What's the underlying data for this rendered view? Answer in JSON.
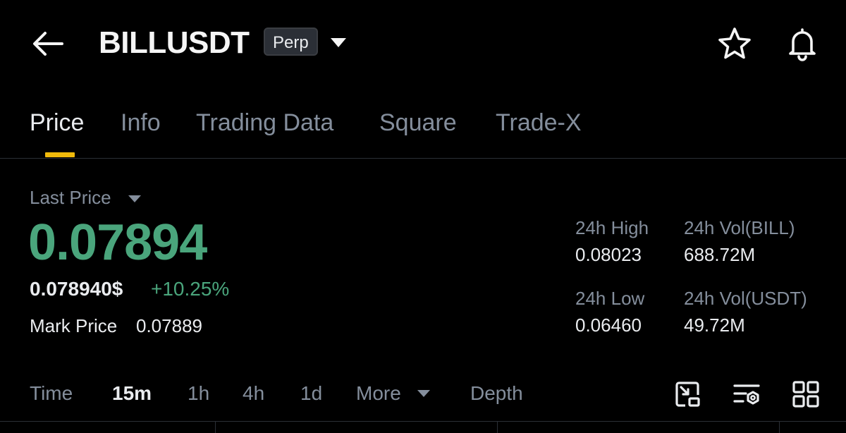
{
  "header": {
    "symbol": "BILLUSDT",
    "contract_type": "Perp",
    "icons": [
      "back-arrow-icon",
      "caret-down-icon",
      "star-icon",
      "bell-icon"
    ]
  },
  "tabs": [
    {
      "label": "Price",
      "active": true
    },
    {
      "label": "Info",
      "active": false
    },
    {
      "label": "Trading Data",
      "active": false
    },
    {
      "label": "Square",
      "active": false
    },
    {
      "label": "Trade-X",
      "active": false
    }
  ],
  "price": {
    "label": "Last Price",
    "last": "0.07894",
    "usd": "0.078940$",
    "change": "+10.25%",
    "mark_label": "Mark Price",
    "mark_value": "0.07889"
  },
  "stats": {
    "high_label": "24h High",
    "high_value": "0.08023",
    "low_label": "24h Low",
    "low_value": "0.06460",
    "vol_base_label": "24h Vol(BILL)",
    "vol_base_value": "688.72M",
    "vol_quote_label": "24h Vol(USDT)",
    "vol_quote_value": "49.72M"
  },
  "intervals": [
    {
      "label": "Time",
      "active": false
    },
    {
      "label": "15m",
      "active": true
    },
    {
      "label": "1h",
      "active": false
    },
    {
      "label": "4h",
      "active": false
    },
    {
      "label": "1d",
      "active": false
    },
    {
      "label": "More",
      "active": false
    },
    {
      "label": "Depth",
      "active": false
    }
  ],
  "colors": {
    "background": "#000000",
    "up_green": "#4aa57c",
    "accent_yellow": "#f0b90b",
    "muted_text": "#848e9c",
    "primary_text": "#eaecef"
  }
}
